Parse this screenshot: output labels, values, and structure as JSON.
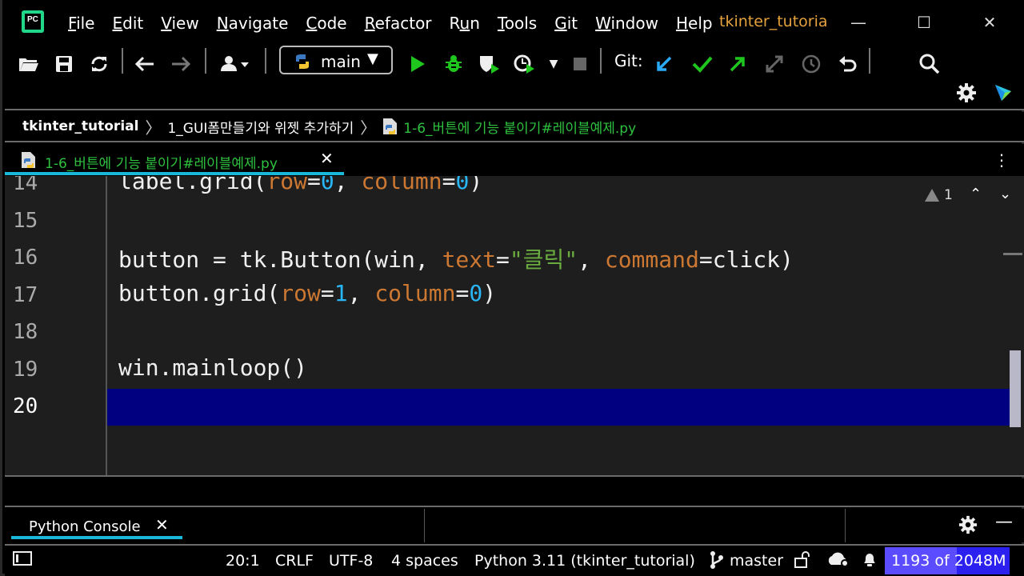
{
  "titlebar": {
    "logo_text": "PC",
    "menu": [
      "File",
      "Edit",
      "View",
      "Navigate",
      "Code",
      "Refactor",
      "Run",
      "Tools",
      "Git",
      "Window",
      "Help"
    ],
    "menu_mnemonic_index": [
      0,
      0,
      0,
      0,
      0,
      0,
      1,
      0,
      0,
      0,
      0
    ],
    "project_title": "tkinter_tutoria",
    "minimize": "—",
    "maximize": "☐",
    "close": "✕"
  },
  "toolbar": {
    "branch_selector": "main",
    "git_label": "Git:",
    "icons": [
      "open-folder-icon",
      "save-icon",
      "sync-icon",
      "back-icon",
      "forward-icon",
      "user-icon",
      "run-icon",
      "debug-icon",
      "coverage-icon",
      "profile-icon",
      "stop-icon",
      "git-update-icon",
      "git-commit-icon",
      "git-push-icon",
      "git-compare-icon",
      "history-icon",
      "rollback-icon",
      "search-icon",
      "settings-icon",
      "plugin-icon"
    ]
  },
  "breadcrumb": {
    "project": "tkinter_tutorial",
    "folder": "1_GUI폼만들기와 위젯 추가하기",
    "file": "1-6_버튼에 기능 붙이기#레이블예제.py"
  },
  "editor_tab": {
    "label": "1-6_버튼에 기능 붙이기#레이블예제.py",
    "close": "✕",
    "more": "⋮"
  },
  "editor": {
    "lines": [
      {
        "n": "14",
        "code": "label.grid(row=0, column=0)"
      },
      {
        "n": "15",
        "code": ""
      },
      {
        "n": "16",
        "code": "button = tk.Button(win, text=\"클릭\", command=click)"
      },
      {
        "n": "17",
        "code": "button.grid(row=1, column=0)"
      },
      {
        "n": "18",
        "code": ""
      },
      {
        "n": "19",
        "code": "win.mainloop()"
      },
      {
        "n": "20",
        "code": ""
      }
    ],
    "current_line": "20",
    "warnings_count": "1"
  },
  "tool_window": {
    "tab_label": "Python Console",
    "close": "✕"
  },
  "statusbar": {
    "position": "20:1",
    "line_sep": "CRLF",
    "encoding": "UTF-8",
    "indent": "4 spaces",
    "interpreter": "Python 3.11 (tkinter_tutorial)",
    "vcs_branch": "master",
    "memory": "1193 of 2048M",
    "memory_used_fraction": 0.58
  },
  "colors": {
    "accent": "#1ab8d8",
    "file_green": "#2ec13f",
    "project_orange": "#e6a23c",
    "current_line": "#000080",
    "memory_bg": "#2b20f0"
  }
}
